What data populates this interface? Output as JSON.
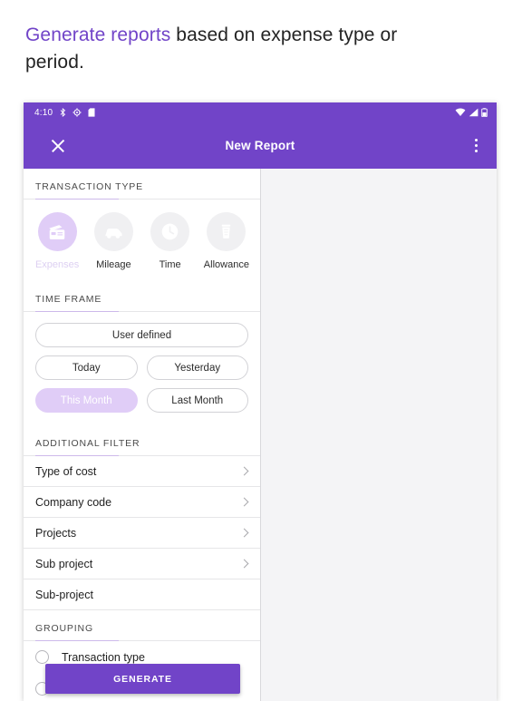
{
  "headline": {
    "accent_text": "Generate reports",
    "rest_text": " based on expense type or period."
  },
  "colors": {
    "primary_purple": "#7144c8",
    "light_purple": "#e0cdf7",
    "panel_bg": "#f4f4f6",
    "text_dark": "#1f1f1f"
  },
  "status_bar": {
    "time": "4:10",
    "left_icons": [
      "bluetooth-icon",
      "location-icon",
      "sim-icon"
    ],
    "right_icons": [
      "wifi-icon",
      "signal-icon",
      "battery-icon"
    ]
  },
  "app_bar": {
    "title": "New Report",
    "close_icon": "close-icon",
    "overflow_icon": "overflow-menu-icon"
  },
  "transaction_type": {
    "header": "TRANSACTION TYPE",
    "items": [
      {
        "label": "Expenses",
        "icon": "credit-card-icon",
        "selected": true
      },
      {
        "label": "Mileage",
        "icon": "car-icon",
        "selected": false
      },
      {
        "label": "Time",
        "icon": "clock-icon",
        "selected": false
      },
      {
        "label": "Allowance",
        "icon": "cup-icon",
        "selected": false
      }
    ]
  },
  "time_frame": {
    "header": "TIME FRAME",
    "user_defined": "User defined",
    "today": "Today",
    "yesterday": "Yesterday",
    "this_month": "This Month",
    "last_month": "Last Month",
    "selected": "This Month"
  },
  "additional_filter": {
    "header": "ADDITIONAL FILTER",
    "rows": [
      {
        "label": "Type of cost",
        "chevron": true
      },
      {
        "label": "Company code",
        "chevron": true
      },
      {
        "label": "Projects",
        "chevron": true
      },
      {
        "label": "Sub project",
        "chevron": true
      },
      {
        "label": "Sub-project",
        "chevron": false
      }
    ]
  },
  "grouping": {
    "header": "GROUPING",
    "options": [
      {
        "label": "Transaction type",
        "selected": false
      }
    ]
  },
  "generate_button": {
    "label": "GENERATE"
  }
}
